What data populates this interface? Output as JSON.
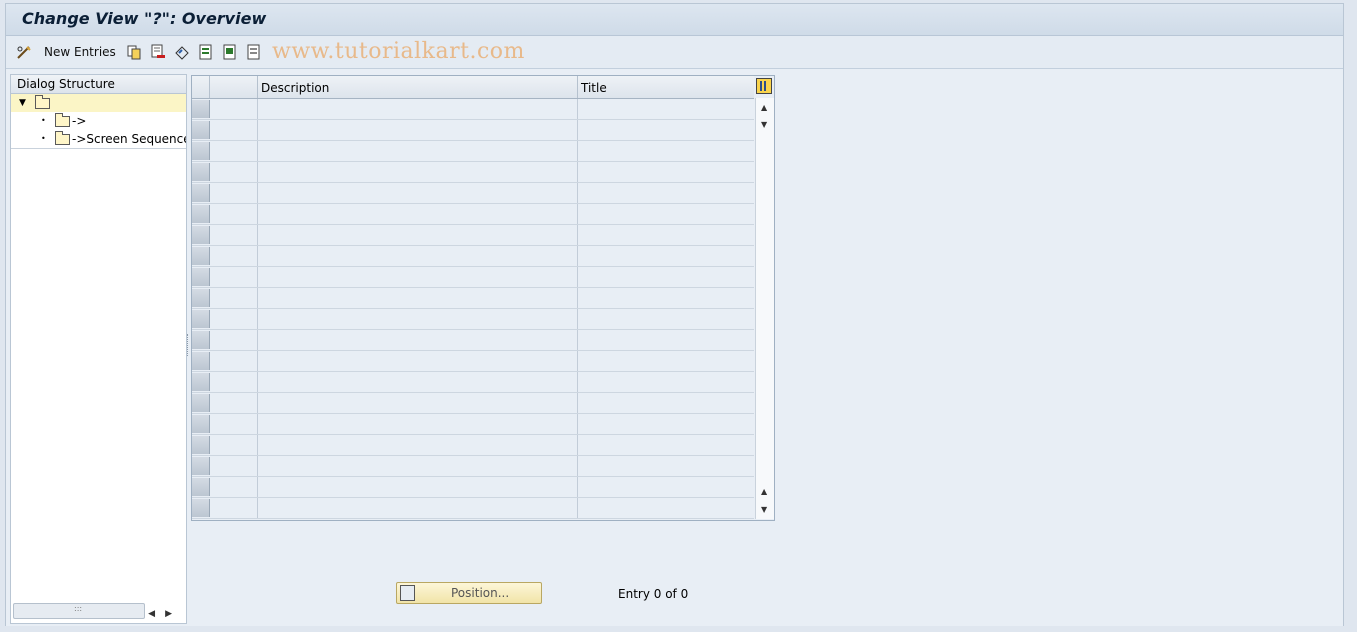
{
  "window": {
    "title": "Change View \"?\": Overview"
  },
  "toolbar": {
    "new_entries_label": "New Entries",
    "watermark": "www.tutorialkart.com",
    "icons": [
      "change-display-icon",
      "copy-icon",
      "delete-icon",
      "undo-icon",
      "select-all-icon",
      "select-block-icon",
      "deselect-all-icon"
    ]
  },
  "dialog_structure": {
    "header": "Dialog Structure",
    "items": [
      {
        "label": "",
        "level": 0,
        "expanded": true,
        "selected": true
      },
      {
        "label": "->",
        "level": 1
      },
      {
        "label": "->Screen Sequences",
        "level": 1
      }
    ]
  },
  "table": {
    "columns": [
      "",
      "Description",
      "Title"
    ],
    "row_count": 20,
    "rows": []
  },
  "footer": {
    "position_label": "Position...",
    "entry_text": "Entry 0 of 0"
  },
  "colors": {
    "background": "#e8eef5",
    "title": "#0b1f36",
    "selected_row": "#fbf5c6",
    "watermark": "#e8b98a"
  }
}
